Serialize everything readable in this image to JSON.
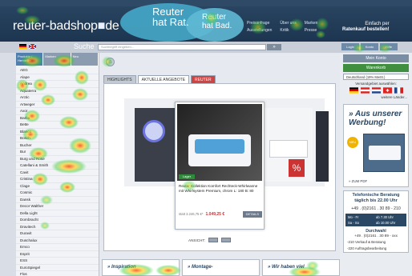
{
  "header": {
    "logo_main": "reuter-badshop",
    "logo_dot": "■",
    "logo_tld": "de",
    "slogan_1": "Reuter hat Rat.",
    "slogan_2": "Reuter hat Bad.",
    "links": [
      "Preisanfrage",
      "Über uns",
      "Marken",
      "Ausstellungen",
      "Kritik",
      "Presse"
    ],
    "promo_line1": "Einfach per",
    "promo_line2": "Ratenkauf bestellen!"
  },
  "search": {
    "label": "Suche",
    "placeholder": "Suchbegriff eingeben...",
    "go": "»",
    "right_buttons": [
      "Login",
      "Konto",
      "Hilfe"
    ]
  },
  "sidebar": {
    "tabs": [
      "Produkte / Hersteller",
      "Marken",
      "Neu"
    ],
    "brands": [
      "AEG",
      "Alape",
      "Andrea",
      "Aquaterra",
      "Arctic",
      "Artweger",
      "Axor",
      "Barbo",
      "Bette",
      "Blanco",
      "Bosch",
      "Bucher",
      "Bur",
      "Burg und Rose",
      "Catellani & Smith",
      "Cavit",
      "Cristina",
      "Clage",
      "Cosmic",
      "Dansk",
      "Decor Walther",
      "Della Light",
      "Dornbracht",
      "Dravitech",
      "Duravit",
      "Duschalux",
      "Emco",
      "Esprit",
      "ESS",
      "EuroSpiegel",
      "Flos"
    ]
  },
  "main": {
    "home_icon": "home-icon",
    "tabs": [
      "HIGHLIGHTS",
      "AKTUELLE ANGEBOTE",
      "REUTER"
    ],
    "lager_badge": "Lager",
    "product_title": "Reuter Kollektion Komfort Rechteck-Whirlwanne mit Whirlsystem Premium, chrom L: 180 B: 80",
    "price_old": "statt 3.246,75 €*",
    "price_new": "1.049,25 €",
    "details_label": "DETAILS",
    "ansicht_label": "ANSICHT:",
    "banners": [
      "» Inspiration",
      "» Montage-",
      "» Wir haben viel"
    ]
  },
  "right": {
    "account_label": "Mein Konto",
    "cart_label": "Warenkorb",
    "country_value": "Deutschland (19% MwSt.)",
    "shipping_text": "Versandgebiet auswählen:",
    "more_countries": "weitere Länder...",
    "ad_title_1": "» Aus unserer",
    "ad_title_2": "Werbung!",
    "ad_neu": "NEU",
    "ad_link": "» ZUM PDF",
    "hotline_title": "Telefonische Beratung täglich bis 22.00 Uhr",
    "hotline_number": "+49 . (0)2161 . 30 89 - 210",
    "hours": [
      "Mo - Fr",
      "ab 7.30 Uhr",
      "Sa - So",
      "ab 10.00 Uhr"
    ],
    "durchwahl_label": "Durchwahl",
    "durchwahl_number": "+49 . (0)2161 . 30 89 - xxx",
    "ext_1": "-210 Verkauf & Beratung",
    "ext_2": "-220 Auftragsbearbeitung"
  },
  "colors": {
    "header_bg": "#1d3550",
    "accent_green": "#3f8f3f",
    "accent_red": "#cc3333",
    "link_blue": "#2a4763"
  }
}
